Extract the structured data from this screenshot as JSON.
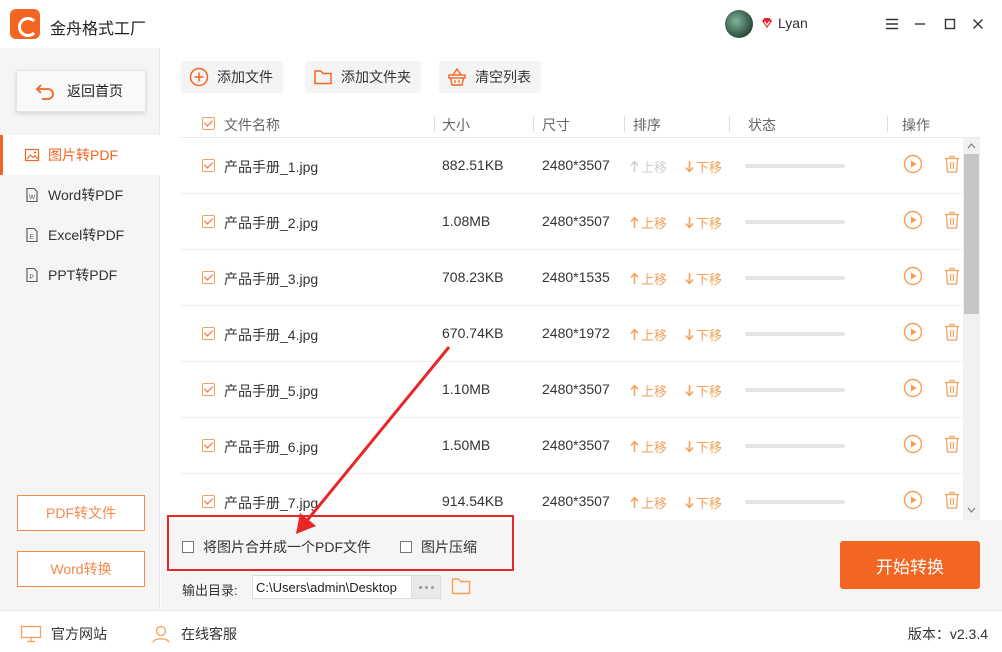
{
  "app": {
    "title": "金舟格式工厂",
    "username": "Lyan"
  },
  "sidebar": {
    "home_label": "返回首页",
    "items": [
      {
        "label": "图片转PDF",
        "active": true,
        "icon": "image-icon"
      },
      {
        "label": "Word转PDF",
        "active": false,
        "icon": "word-doc-icon"
      },
      {
        "label": "Excel转PDF",
        "active": false,
        "icon": "excel-doc-icon"
      },
      {
        "label": "PPT转PDF",
        "active": false,
        "icon": "ppt-doc-icon"
      }
    ],
    "bottom_buttons": [
      "PDF转文件",
      "Word转换"
    ]
  },
  "toolbar": {
    "add_file": "添加文件",
    "add_folder": "添加文件夹",
    "clear_list": "清空列表"
  },
  "table": {
    "headers": [
      "文件名称",
      "大小",
      "尺寸",
      "排序",
      "状态",
      "操作"
    ],
    "move_up": "上移",
    "move_down": "下移",
    "rows": [
      {
        "name": "产品手册_1.jpg",
        "size": "882.51KB",
        "dims": "2480*3507",
        "up_disabled": true
      },
      {
        "name": "产品手册_2.jpg",
        "size": "1.08MB",
        "dims": "2480*3507",
        "up_disabled": false
      },
      {
        "name": "产品手册_3.jpg",
        "size": "708.23KB",
        "dims": "2480*1535",
        "up_disabled": false
      },
      {
        "name": "产品手册_4.jpg",
        "size": "670.74KB",
        "dims": "2480*1972",
        "up_disabled": false
      },
      {
        "name": "产品手册_5.jpg",
        "size": "1.10MB",
        "dims": "2480*3507",
        "up_disabled": false
      },
      {
        "name": "产品手册_6.jpg",
        "size": "1.50MB",
        "dims": "2480*3507",
        "up_disabled": false
      },
      {
        "name": "产品手册_7.jpg",
        "size": "914.54KB",
        "dims": "2480*3507",
        "up_disabled": false
      }
    ]
  },
  "options": {
    "merge_pdf": "将图片合并成一个PDF文件",
    "compress": "图片压缩"
  },
  "output": {
    "label": "输出目录:",
    "path": "C:\\Users\\admin\\Desktop"
  },
  "start_button": "开始转换",
  "statusbar": {
    "website": "官方网站",
    "support": "在线客服",
    "version": "版本：v2.3.4"
  },
  "colors": {
    "accent": "#f26522",
    "annotation": "#e8262a"
  }
}
